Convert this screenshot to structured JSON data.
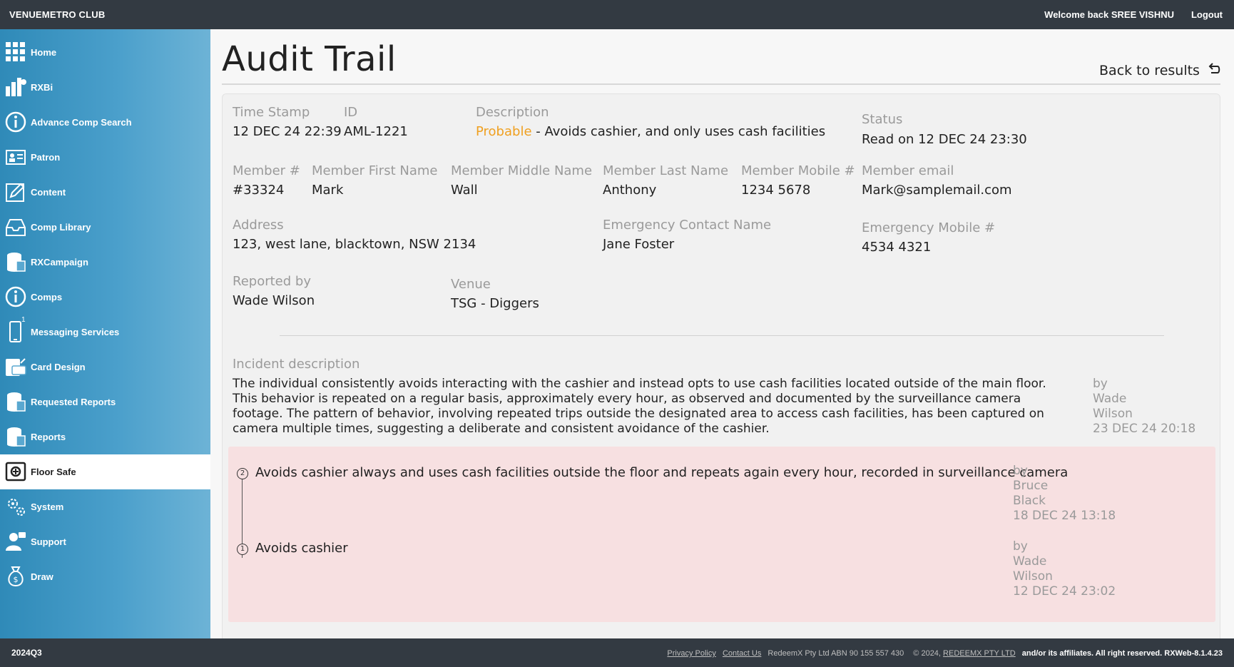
{
  "header": {
    "brand": "VENUEMETRO CLUB",
    "welcome_prefix": "Welcome back ",
    "username": "SREE VISHNU",
    "logout": "Logout"
  },
  "sidebar": {
    "items": [
      {
        "label": "Home",
        "icon": "grid-icon"
      },
      {
        "label": "RXBi",
        "icon": "chart-icon"
      },
      {
        "label": "Advance Comp Search",
        "icon": "info-icon"
      },
      {
        "label": "Patron",
        "icon": "id-card-icon"
      },
      {
        "label": "Content",
        "icon": "edit-icon"
      },
      {
        "label": "Comp Library",
        "icon": "tray-icon"
      },
      {
        "label": "RXCampaign",
        "icon": "database-icon"
      },
      {
        "label": "Comps",
        "icon": "info-icon"
      },
      {
        "label": "Messaging Services",
        "icon": "phone-icon",
        "badge": "1"
      },
      {
        "label": "Card Design",
        "icon": "card-icon"
      },
      {
        "label": "Requested Reports",
        "icon": "database-icon"
      },
      {
        "label": "Reports",
        "icon": "database-icon"
      },
      {
        "label": "Floor Safe",
        "icon": "safe-icon",
        "active": true
      },
      {
        "label": "System",
        "icon": "gears-icon"
      },
      {
        "label": "Support",
        "icon": "support-icon"
      },
      {
        "label": "Draw",
        "icon": "money-bag-icon"
      }
    ]
  },
  "page": {
    "title": "Audit Trail",
    "back_label": "Back to results"
  },
  "record": {
    "timestamp_label": "Time Stamp",
    "timestamp": "12 DEC 24 22:39",
    "id_label": "ID",
    "id": "AML-1221",
    "description_label": "Description",
    "description_status": "Probable",
    "description_text": " - Avoids cashier, and only uses cash facilities",
    "status_label": "Status",
    "status": "Read on 12 DEC 24 23:30",
    "member_no_label": "Member #",
    "member_no": "#33324",
    "first_name_label": "Member First Name",
    "first_name": "Mark",
    "middle_name_label": "Member Middle Name",
    "middle_name": "Wall",
    "last_name_label": "Member Last Name",
    "last_name": "Anthony",
    "mobile_label": "Member Mobile #",
    "mobile": "1234 5678",
    "email_label": "Member email",
    "email": "Mark@samplemail.com",
    "address_label": "Address",
    "address": "123, west lane, blacktown, NSW 2134",
    "emergency_name_label": "Emergency Contact Name",
    "emergency_name": "Jane Foster",
    "emergency_mobile_label": "Emergency Mobile #",
    "emergency_mobile": "4534 4321",
    "reported_by_label": "Reported by",
    "reported_by": "Wade Wilson",
    "venue_label": "Venue",
    "venue": "TSG - Diggers"
  },
  "incident": {
    "label": "Incident description",
    "lines": [
      "The individual consistently avoids interacting with the cashier and instead opts to use cash facilities located outside of the main floor.",
      "This behavior is repeated on a regular basis, approximately every hour, as observed and documented by the surveillance camera",
      "footage. The pattern of behavior, involving repeated trips outside the designated area to access cash facilities, has been captured on",
      "camera multiple times, suggesting a deliberate and consistent avoidance of the cashier."
    ],
    "by": [
      "by",
      "Wade",
      "Wilson",
      "23 DEC 24 20:18"
    ]
  },
  "history": [
    {
      "num": "2",
      "text": "Avoids cashier always and uses cash facilities outside the floor and repeats again every hour, recorded in surveillance camera",
      "by": [
        "by",
        "Bruce",
        "Black",
        "18 DEC 24 13:18"
      ]
    },
    {
      "num": "1",
      "text": "Avoids cashier",
      "by": [
        "by",
        "Wade",
        "Wilson",
        "12 DEC 24 23:02"
      ]
    }
  ],
  "footer": {
    "version_left": "2024Q3",
    "privacy": "Privacy Policy",
    "contact": "Contact Us",
    "company": "RedeemX Pty Ltd ABN 90 155 557 430",
    "copyright_prefix": "© 2024, ",
    "copyright_link": "REDEEMX PTY LTD",
    "rights": "and/or its affiliates. All right reserved. RXWeb-8.1.4.23"
  },
  "colors": {
    "topbar": "#333a42",
    "sidebar": "#4a9fcb",
    "probable": "#f0a020",
    "history_bg": "#f7e0e1"
  }
}
